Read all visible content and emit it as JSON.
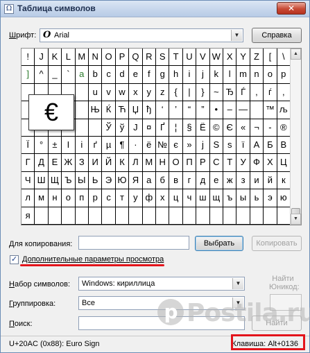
{
  "window": {
    "title": "Таблица символов",
    "close_label": "✕"
  },
  "font_row": {
    "label": "Шрифт:",
    "font_icon": "italic-o-font-icon",
    "font_icon_glyph": "O",
    "value": "Arial",
    "help_button": "Справка"
  },
  "grid": {
    "rows": [
      [
        "!",
        "J",
        "K",
        "L",
        "M",
        "N",
        "O",
        "P",
        "Q",
        "R",
        "S",
        "T",
        "U",
        "V",
        "W",
        "X",
        "Y",
        "Z",
        "[",
        "\\"
      ],
      [
        "]",
        "^",
        "_",
        "`",
        "a",
        "b",
        "c",
        "d",
        "e",
        "f",
        "g",
        "h",
        "i",
        "j",
        "k",
        "l",
        "m",
        "n",
        "o",
        "p"
      ],
      [
        "",
        "",
        "",
        "",
        "",
        "u",
        "v",
        "w",
        "x",
        "y",
        "z",
        "{",
        "|",
        "}",
        "~",
        "Ђ",
        "Ѓ",
        ",",
        "ѓ",
        ","
      ],
      [
        "",
        "",
        "",
        "",
        "",
        "Њ",
        "Ќ",
        "Ћ",
        "Џ",
        "ђ",
        "‘",
        "’",
        "“",
        "”",
        "•",
        "–",
        "—",
        "",
        "™",
        "љ"
      ],
      [
        "",
        "",
        "",
        "",
        "",
        "",
        "Ў",
        "ў",
        "Ј",
        "¤",
        "Ґ",
        "¦",
        "§",
        "Ё",
        "©",
        "Є",
        "«",
        "¬",
        "-",
        "®"
      ],
      [
        "Ї",
        "°",
        "±",
        "І",
        "і",
        "ґ",
        "µ",
        "¶",
        "·",
        "ё",
        "№",
        "є",
        "»",
        "ј",
        "Ѕ",
        "ѕ",
        "ї",
        "А",
        "Б",
        "В"
      ],
      [
        "Г",
        "Д",
        "Е",
        "Ж",
        "З",
        "И",
        "Й",
        "К",
        "Л",
        "М",
        "Н",
        "О",
        "П",
        "Р",
        "С",
        "Т",
        "У",
        "Ф",
        "Х",
        "Ц"
      ],
      [
        "Ч",
        "Ш",
        "Щ",
        "Ъ",
        "Ы",
        "Ь",
        "Э",
        "Ю",
        "Я",
        "а",
        "б",
        "в",
        "г",
        "д",
        "е",
        "ж",
        "з",
        "и",
        "й",
        "к"
      ],
      [
        "л",
        "м",
        "н",
        "о",
        "п",
        "р",
        "с",
        "т",
        "у",
        "ф",
        "х",
        "ц",
        "ч",
        "ш",
        "щ",
        "ъ",
        "ы",
        "ь",
        "э",
        "ю"
      ],
      [
        "я",
        "",
        "",
        "",
        "",
        "",
        "",
        "",
        "",
        "",
        "",
        "",
        "",
        "",
        "",
        "",
        "",
        "",
        "",
        ""
      ]
    ],
    "green_cells": [
      [
        1,
        0
      ],
      [
        1,
        4
      ]
    ],
    "selected_char": "€"
  },
  "copy_row": {
    "label": "Для копирования:",
    "value": "",
    "select_button": "Выбрать",
    "copy_button": "Копировать"
  },
  "advanced": {
    "checkbox_mark": "✓",
    "label": "Дополнительные параметры просмотра",
    "checked": true
  },
  "charset_row": {
    "label": "Набор символов:",
    "value": "Windows: кириллица"
  },
  "grouping_row": {
    "label": "Группировка:",
    "value": "Все"
  },
  "search_row": {
    "label": "Поиск:",
    "value": "",
    "button": "Найти"
  },
  "unicode_find": {
    "label": "Найти Юникод:",
    "value": ""
  },
  "status": {
    "left": "U+20AC (0x88): Euro Sign",
    "right": "Клавиша: Alt+0136"
  },
  "watermark": {
    "icon_letter": "p",
    "text": "Postila.ru"
  },
  "colors": {
    "highlight": "#e3141b",
    "green_char": "#2b7a2b"
  }
}
